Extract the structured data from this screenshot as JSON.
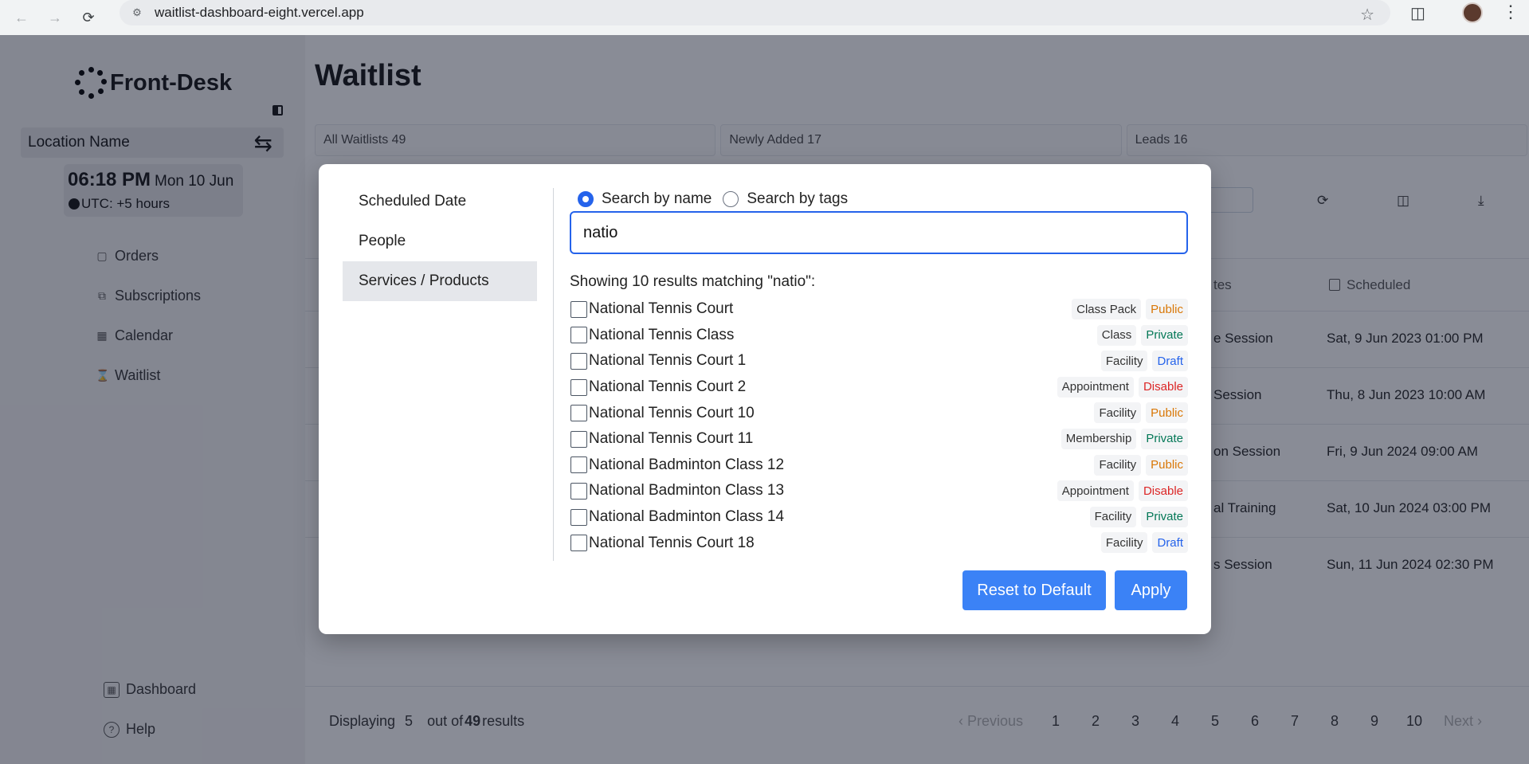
{
  "browser": {
    "url": "waitlist-dashboard-eight.vercel.app"
  },
  "sidebar": {
    "brand": "Front-Desk",
    "location": "Location Name",
    "time": "06:18 PM",
    "date": "Mon 10 Jun",
    "timezone": "UTC: +5 hours",
    "nav": [
      {
        "label": "Orders",
        "icon": "bag-icon"
      },
      {
        "label": "Subscriptions",
        "icon": "subscriptions-icon"
      },
      {
        "label": "Calendar",
        "icon": "calendar-icon"
      },
      {
        "label": "Waitlist",
        "icon": "hourglass-icon"
      }
    ],
    "bottom": [
      {
        "label": "Dashboard",
        "icon": "dashboard-icon"
      },
      {
        "label": "Help",
        "icon": "help-icon"
      }
    ]
  },
  "main": {
    "title": "Waitlist",
    "tabs": [
      "All Waitlists 49",
      "Newly Added 17",
      "Leads 16"
    ],
    "columns": {
      "services_partial": "tes",
      "scheduled": "Scheduled"
    },
    "rows": [
      {
        "service_partial": "e Session",
        "scheduled": "Sat, 9 Jun 2023 01:00 PM"
      },
      {
        "service_partial": "Session",
        "scheduled": "Thu, 8 Jun 2023 10:00 AM"
      },
      {
        "service_partial": "on Session",
        "scheduled": "Fri, 9 Jun 2024 09:00 AM"
      },
      {
        "service_partial": "al Training",
        "scheduled": "Sat, 10 Jun 2024 03:00 PM"
      },
      {
        "service_partial": "s Session",
        "scheduled": "Sun, 11 Jun 2024 02:30 PM"
      }
    ],
    "footer": {
      "displaying": "Displaying",
      "count": "5",
      "out_of": "out of",
      "total": "49",
      "results": "results"
    },
    "pagination": {
      "previous": "Previous",
      "next": "Next",
      "pages": [
        "1",
        "2",
        "3",
        "4",
        "5",
        "6",
        "7",
        "8",
        "9",
        "10"
      ]
    }
  },
  "modal": {
    "nav": [
      "Scheduled Date",
      "People",
      "Services / Products"
    ],
    "active_nav": "Services / Products",
    "search_by_name": "Search by name",
    "search_by_tags": "Search by tags",
    "search_value": "natio",
    "results_label": "Showing 10 results matching \"natio\":",
    "results": [
      {
        "name": "National Tennis Court",
        "type": "Class Pack",
        "status": "Public"
      },
      {
        "name": "National Tennis Class",
        "type": "Class",
        "status": "Private"
      },
      {
        "name": "National Tennis Court 1",
        "type": "Facility",
        "status": "Draft"
      },
      {
        "name": "National Tennis Court 2",
        "type": "Appointment",
        "status": "Disable"
      },
      {
        "name": "National Tennis Court 10",
        "type": "Facility",
        "status": "Public"
      },
      {
        "name": "National Tennis Court 11",
        "type": "Membership",
        "status": "Private"
      },
      {
        "name": "National Badminton Class 12",
        "type": "Facility",
        "status": "Public"
      },
      {
        "name": "National Badminton Class 13",
        "type": "Appointment",
        "status": "Disable"
      },
      {
        "name": "National Badminton Class 14",
        "type": "Facility",
        "status": "Private"
      },
      {
        "name": "National Tennis Court 18",
        "type": "Facility",
        "status": "Draft"
      }
    ],
    "reset_label": "Reset to Default",
    "apply_label": "Apply"
  },
  "colors": {
    "accent": "#3b82f6",
    "public": "#d97706",
    "private": "#047857",
    "draft": "#2563eb",
    "disable": "#dc2626"
  }
}
